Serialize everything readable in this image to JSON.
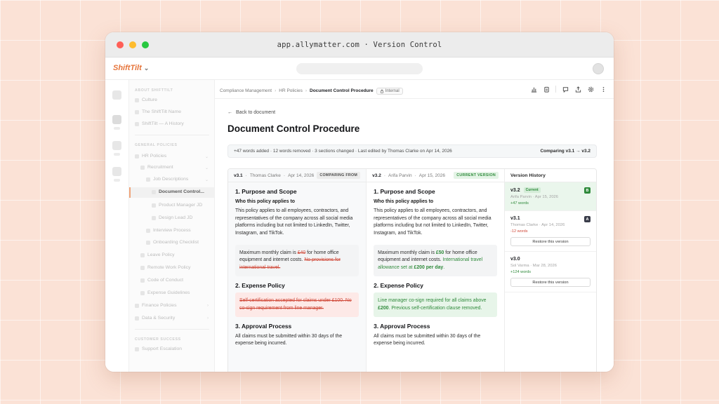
{
  "window": {
    "url": "app.allymatter.com · Version Control"
  },
  "app": {
    "brand": "ShiftTilt"
  },
  "sidebar": {
    "section1": "ABOUT SHIFTTILT",
    "section2": "GENERAL POLICIES",
    "section3": "CUSTOMER SUCCESS",
    "items": {
      "culture": "Culture",
      "name": "The ShiftTilt Name",
      "history": "ShiftTilt — A History",
      "hr": "HR Policies",
      "recruitment": "Recruitment",
      "job_desc": "Job Descriptions",
      "doc_control": "Document Control...",
      "pm_jd": "Product Manager JD",
      "design_jd": "Design Lead JD",
      "interview": "Interview Process",
      "onboarding": "Onboarding Checklist",
      "leave": "Leave Policy",
      "remote": "Remote Work Policy",
      "conduct": "Code of Conduct",
      "expense": "Expense Guidelines",
      "finance": "Finance Policies",
      "data": "Data & Security",
      "support": "Support Escalation"
    }
  },
  "breadcrumb": {
    "c1": "Compliance Management",
    "c2": "HR Policies",
    "c3": "Document Control Procedure",
    "badge": "Internal"
  },
  "page": {
    "back": "Back to document",
    "title": "Document Control Procedure",
    "summary": "+47 words added · 12 words removed · 3 sections changed · Last edited by Thomas Clarke on Apr 14, 2026",
    "comparing": "Comparing v3.1 → v3.2"
  },
  "left": {
    "ver": "v3.1",
    "author": "Thomas Clarke",
    "date": "Apr 14, 2026",
    "pill": "COMPARING FROM",
    "s1": "1. Purpose and Scope",
    "s1_sub": "Who this policy applies to",
    "s1_p": "This policy applies to all employees, contractors, and representatives of the company across all social media platforms including but not limited to LinkedIn, Twitter, Instagram, and TikTok.",
    "box_a": "Maximum monthly claim is ",
    "box_del1": "£40",
    "box_b": " for home office equipment and internet costs. ",
    "box_del2": "No provisions for international travel.",
    "s2": "2. Expense Policy",
    "s2_del": "Self-certification accepted for claims under £100. No co-sign requirement from line manager.",
    "s3": "3. Approval Process",
    "s3_p": "All claims must be submitted within 30 days of the expense being incurred."
  },
  "right": {
    "ver": "v3.2",
    "author": "Arifa Parvin",
    "date": "Apr 15, 2026",
    "pill": "CURRENT VERSION",
    "s1": "1. Purpose and Scope",
    "s1_sub": "Who this policy applies to",
    "s1_p": "This policy applies to all employees, contractors, and representatives of the company across all social media platforms including but not limited to LinkedIn, Twitter, Instagram, and TikTok.",
    "box_a": "Maximum monthly claim is ",
    "box_ins1": "£50",
    "box_b": " for home office equipment and internet costs. ",
    "box_ins2": "International travel allowance set at ",
    "box_ins3": "£200 per day",
    "box_c": ".",
    "s2": "2. Expense Policy",
    "s2_a": "Line manager co-sign required for all claims above ",
    "s2_b": "£200",
    "s2_c": ". Previous self-certification clause removed.",
    "s3": "3. Approval Process",
    "s3_p": "All claims must be submitted within 30 days of the expense being incurred."
  },
  "history": {
    "title": "Version History",
    "entries": [
      {
        "ver": "v3.2",
        "current": "Current",
        "tag": "B",
        "meta": "Arifa Parvin · Apr 15, 2026",
        "delta": "+47 words"
      },
      {
        "ver": "v3.1",
        "tag": "A",
        "meta": "Thomas Clarke · Apr 14, 2026",
        "delta": "-12 words",
        "restore": "Restore this version"
      },
      {
        "ver": "v3.0",
        "meta": "Sol Varma · Mar 28, 2026",
        "delta": "+124 words",
        "restore": "Restore this version"
      }
    ]
  },
  "colors": {
    "accent": "#e6743a",
    "added": "#2f8a3b",
    "removed": "#d04a3a",
    "background": "#fbe2d6"
  },
  "icons": [
    "chart-icon",
    "clipboard-icon",
    "comment-icon",
    "share-icon",
    "settings-icon",
    "more-icon",
    "lock-icon",
    "arrow-left-icon"
  ]
}
